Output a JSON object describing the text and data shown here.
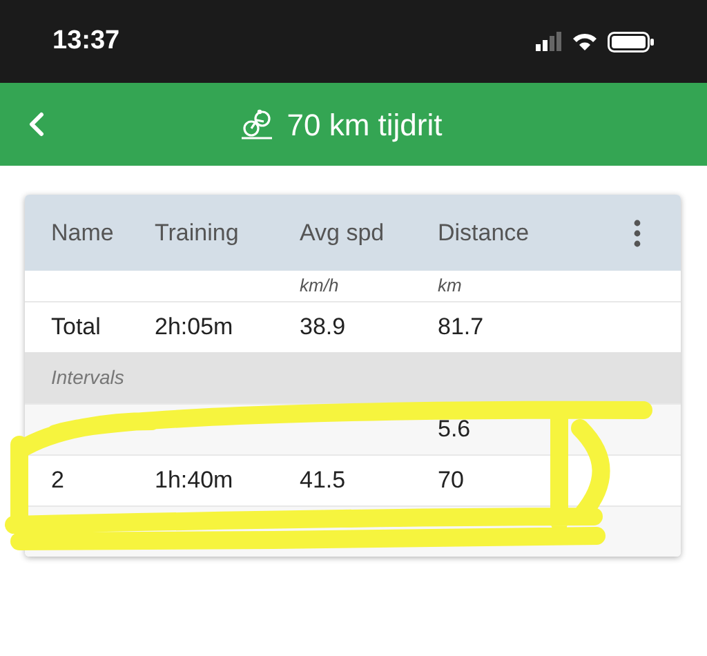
{
  "status_bar": {
    "time": "13:37"
  },
  "header": {
    "title": "70 km tijdrit"
  },
  "table": {
    "columns": [
      {
        "label": "Name"
      },
      {
        "label": "Training"
      },
      {
        "label": "Avg spd",
        "unit": "km/h"
      },
      {
        "label": "Distance",
        "unit": "km"
      }
    ],
    "total": [
      "Total",
      "2h:05m",
      "38.9",
      "81.7"
    ],
    "section": "Intervals",
    "rows": [
      {
        "distance": "5.6"
      },
      {
        "name": "2",
        "training": "1h:40m",
        "avg_spd": "41.5",
        "distance": "70"
      },
      {}
    ]
  }
}
